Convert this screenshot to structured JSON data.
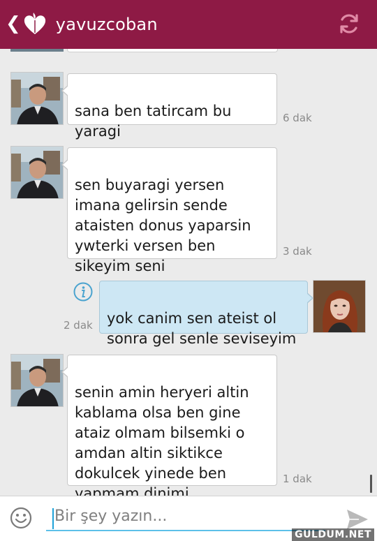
{
  "header": {
    "back_icon": "chevron-left-icon",
    "logo_icon": "heart-logo-icon",
    "title": "yavuzcoban",
    "refresh_icon": "refresh-icon",
    "color": "#8e1a45"
  },
  "messages": [
    {
      "direction": "received",
      "text": "sana ben tatircam bu\nyaragi",
      "time": "6 dak"
    },
    {
      "direction": "received",
      "text": "sen buyaragi yersen\nimana gelirsin sende\nataisten donus yaparsin\nywterki versen ben\nsikeyim seni",
      "time": "3 dak"
    },
    {
      "direction": "sent",
      "text": "yok canim sen ateist ol\nsonra gel senle seviseyim",
      "time": "2 dak",
      "status_icon": "info-icon"
    },
    {
      "direction": "received",
      "text": "senin amin heryeri altin\nkablama olsa ben gine\nataiz olmam bilsemki o\namdan altin siktikce\ndokulcek yinede ben\nyapmam dinimi deyismem",
      "time": "1 dak"
    }
  ],
  "composer": {
    "emoji_icon": "smiley-icon",
    "placeholder": "Bir şey yazın...",
    "send_icon": "send-icon"
  },
  "watermark": "GULDUM.NET",
  "colors": {
    "sent_bubble": "#cde7f4",
    "received_bubble": "#ffffff",
    "input_underline": "#5cc0e8"
  }
}
